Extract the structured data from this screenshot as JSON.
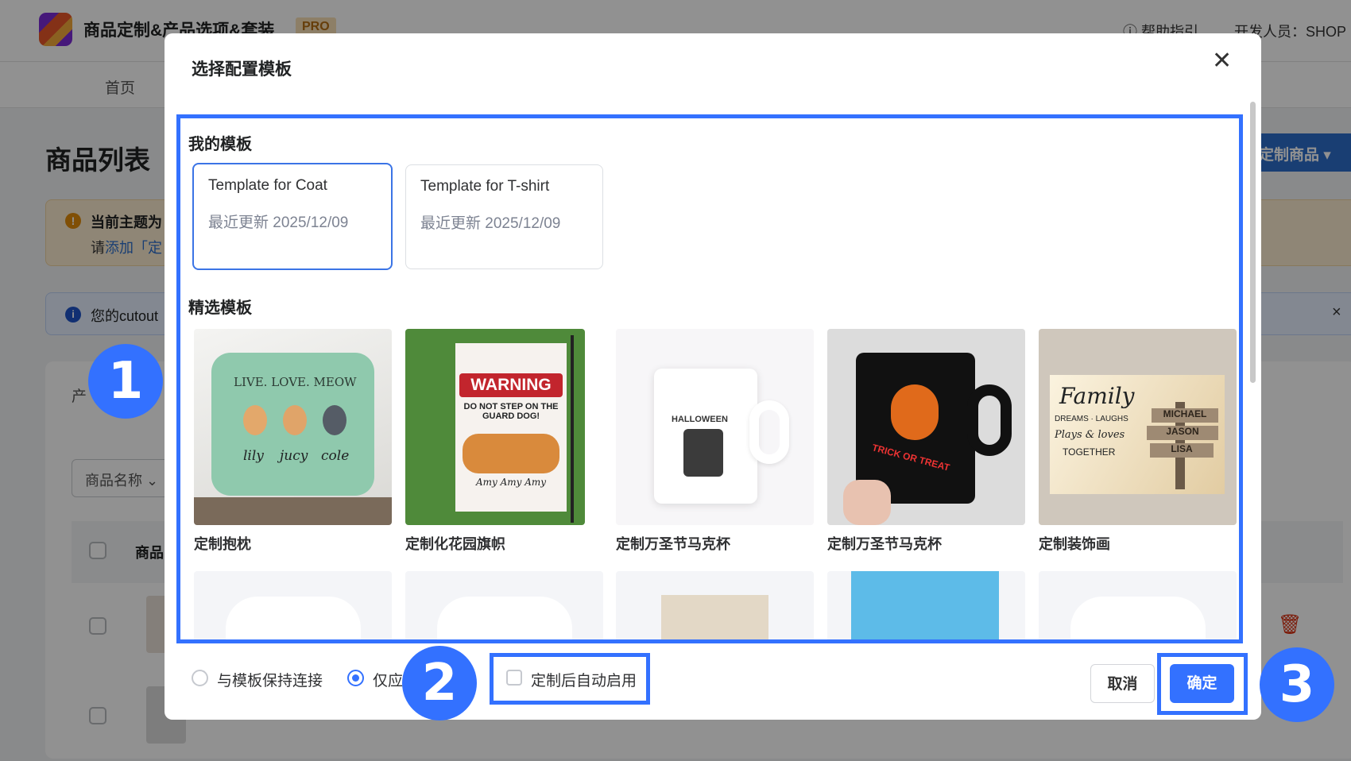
{
  "app": {
    "title": "商品定制&产品选项&套装",
    "badge": "PRO",
    "help": "帮助指引",
    "developer": "开发人员：SHOP",
    "nav_home": "首页"
  },
  "page": {
    "title": "商品列表",
    "warning_line1": "当前主题为",
    "warning_line2_prefix": "请",
    "warning_line2_link": "添加「定",
    "info": "您的cutout",
    "info_close": "×",
    "card_label": "产",
    "name_select": "商品名称 ⌄",
    "table_header": "商品",
    "add_button": "定制商品 ▾",
    "trash": "🗑"
  },
  "modal": {
    "title": "选择配置模板",
    "close": "✕",
    "my_templates_heading": "我的模板",
    "my_templates": [
      {
        "name": "Template for Coat",
        "updated": "最近更新 2025/12/09",
        "selected": true
      },
      {
        "name": "Template for T-shirt",
        "updated": "最近更新 2025/12/09",
        "selected": false
      }
    ],
    "featured_heading": "精选模板",
    "featured": [
      {
        "label": "定制抱枕",
        "art": [
          "LIVE. LOVE. MEOW",
          "lily",
          "jucy",
          "cole"
        ]
      },
      {
        "label": "定制化花园旗帜",
        "art": [
          "WARNING",
          "DO NOT STEP ON THE GUARD DOG!",
          "Amy  Amy  Amy"
        ]
      },
      {
        "label": "定制万圣节马克杯",
        "art": [
          "HALLOWEEN"
        ]
      },
      {
        "label": "定制万圣节马克杯",
        "art": [
          "TRICK OR TREAT"
        ]
      },
      {
        "label": "定制装饰画",
        "art": [
          "Family",
          "DREAMS · LAUGHS",
          "Plays & loves",
          "TOGETHER",
          "MICHAEL",
          "JASON",
          "LISA"
        ]
      }
    ],
    "footer": {
      "radio_keep_link": "与模板保持连接",
      "radio_apply_only": "仅应",
      "radio_selected": "apply_only",
      "checkbox_auto_enable": "定制后自动启用",
      "checkbox_checked": false,
      "cancel": "取消",
      "confirm": "确定"
    }
  },
  "annotations": {
    "step1": "1",
    "step2": "2",
    "step3": "3",
    "color": "#3371ff"
  }
}
